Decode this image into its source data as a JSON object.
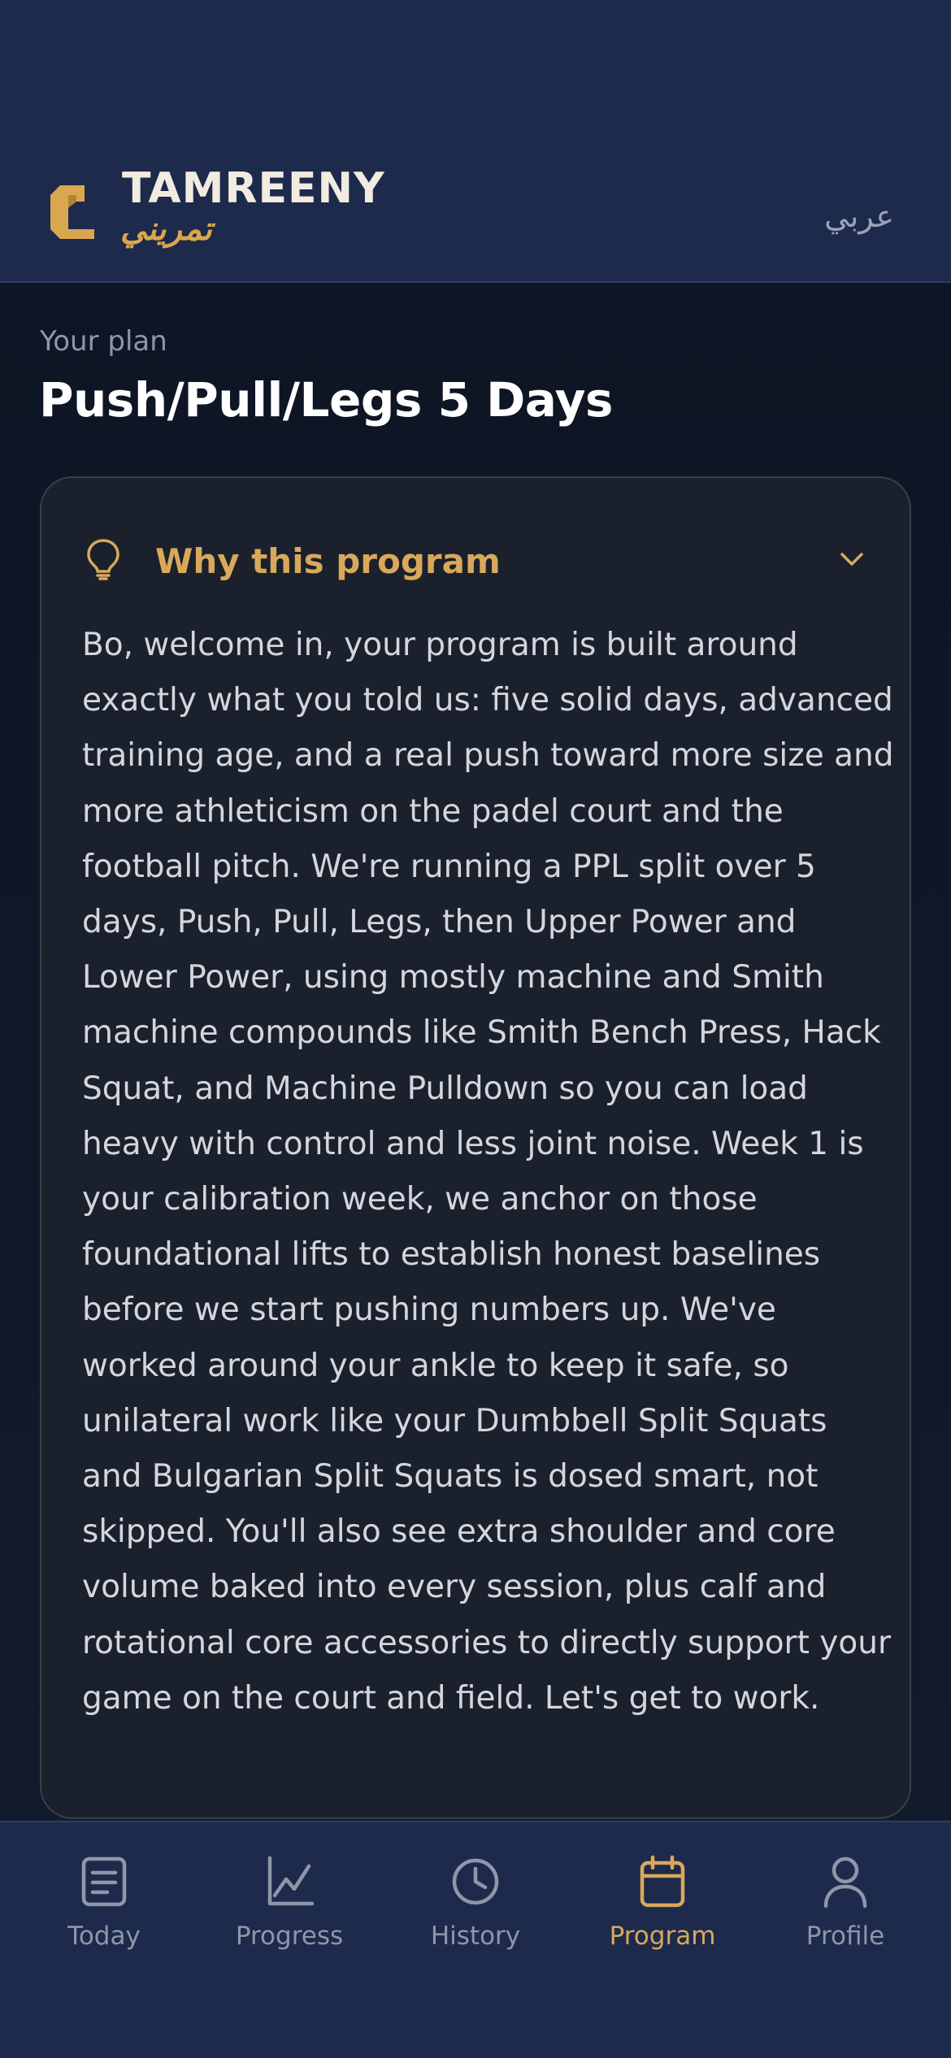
{
  "header": {
    "brand_name": "TAMREENY",
    "brand_arabic": "تمريني",
    "language_toggle": "عربي",
    "logo_icon": "tamreeny-logo-icon"
  },
  "plan": {
    "eyebrow": "Your plan",
    "title": "Push/Pull/Legs 5 Days"
  },
  "why_card": {
    "title": "Why this program",
    "icon": "lightbulb-icon",
    "toggle_icon": "chevron-down-icon",
    "body": "Bo, welcome in, your program is built around exactly what you told us: five solid days, advanced training age, and a real push toward more size and more athleticism on the padel court and the football pitch. We're running a PPL split over 5 days, Push, Pull, Legs, then Upper Power and Lower Power, using mostly machine and Smith machine compounds like Smith Bench Press, Hack Squat, and Machine Pulldown so you can load heavy with control and less joint noise. Week 1 is your calibration week, we anchor on those foundational lifts to establish honest baselines before we start pushing numbers up. We've worked around your ankle to keep it safe, so unilateral work like your Dumbbell Split Squats and Bulgarian Split Squats is dosed smart, not skipped. You'll also see extra shoulder and core volume baked into every session, plus calf and rotational core accessories to directly support your game on the court and field. Let's get to work."
  },
  "tabbar": {
    "active": "Program",
    "items": [
      {
        "label": "Today",
        "icon": "clipboard-icon"
      },
      {
        "label": "Progress",
        "icon": "chart-icon"
      },
      {
        "label": "History",
        "icon": "clock-icon"
      },
      {
        "label": "Program",
        "icon": "calendar-icon"
      },
      {
        "label": "Profile",
        "icon": "person-icon"
      }
    ]
  },
  "colors": {
    "accent": "#d9a85a",
    "header_bg": "#1d2a4c",
    "page_bg": "#0f1a2b",
    "card_bg": "#1a212c",
    "muted_text": "#8e97a8"
  }
}
